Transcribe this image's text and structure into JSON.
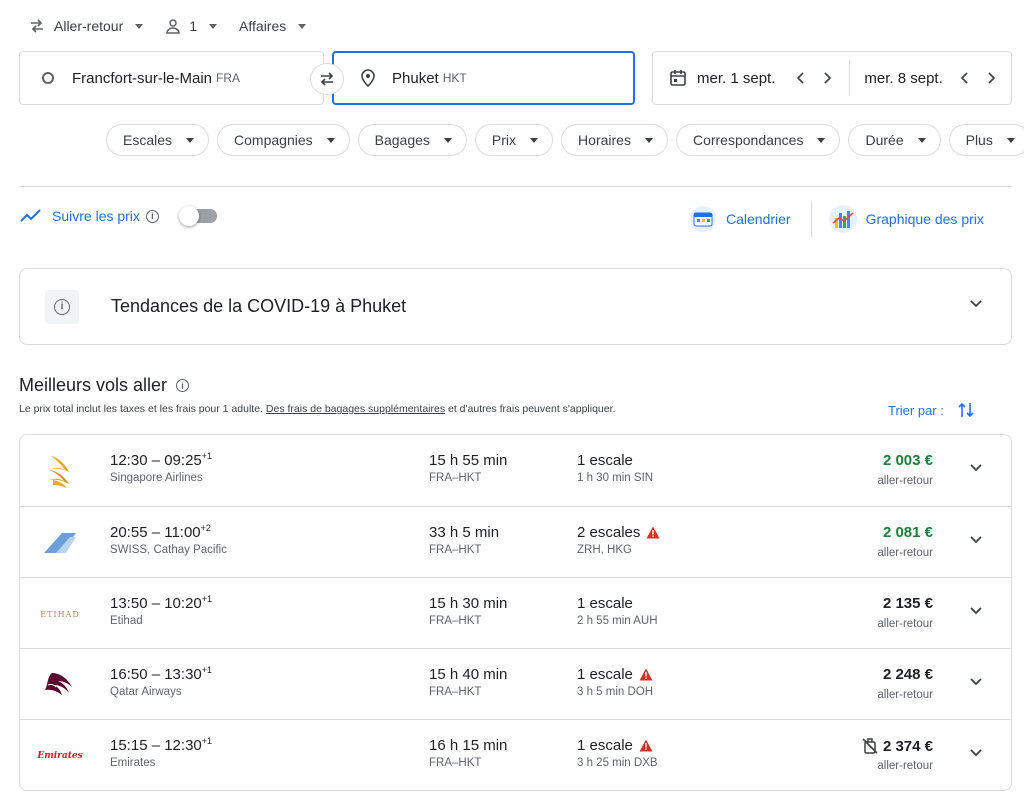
{
  "options": {
    "trip_type": "Aller-retour",
    "passengers": "1",
    "cabin": "Affaires"
  },
  "search": {
    "origin_city": "Francfort-sur-le-Main",
    "origin_code": "FRA",
    "destination_city": "Phuket",
    "destination_code": "HKT",
    "depart_date": "mer. 1 sept.",
    "return_date": "mer. 8 sept."
  },
  "filters": [
    "Escales",
    "Compagnies",
    "Bagages",
    "Prix",
    "Horaires",
    "Correspondances",
    "Durée",
    "Plus"
  ],
  "track": {
    "label": "Suivre les prix",
    "info": "i"
  },
  "views": {
    "calendar": "Calendrier",
    "price_graph": "Graphique des prix"
  },
  "covid": {
    "title": "Tendances de la COVID-19 à Phuket",
    "info": "i"
  },
  "section": {
    "title": "Meilleurs vols aller",
    "info": "i",
    "sub_before": "Le prix total inclut les taxes et les frais pour 1 adulte.",
    "sub_link": "Des frais de bagages supplémentaires",
    "sub_after": "et d'autres frais peuvent s'appliquer.",
    "sort_label": "Trier par :"
  },
  "colors": {
    "accent": "#1a73e8",
    "price_green": "#188038",
    "warning": "#d93025"
  },
  "flights": [
    {
      "times": "12:30 – 09:25",
      "day_offset": "+1",
      "airline": "Singapore Airlines",
      "duration": "15 h 55 min",
      "route": "FRA–HKT",
      "stops": "1 escale",
      "warning": false,
      "layover": "1 h 30 min SIN",
      "price": "2 003 €",
      "price_type": "aller-retour",
      "green": true,
      "no_bag": false,
      "logo": "singapore-airlines-logo"
    },
    {
      "times": "20:55 – 11:00",
      "day_offset": "+2",
      "airline": "SWISS, Cathay Pacific",
      "duration": "33 h 5 min",
      "route": "FRA–HKT",
      "stops": "2 escales",
      "warning": true,
      "layover": "ZRH, HKG",
      "price": "2 081 €",
      "price_type": "aller-retour",
      "green": true,
      "no_bag": false,
      "logo": "multi-airline-logo"
    },
    {
      "times": "13:50 – 10:20",
      "day_offset": "+1",
      "airline": "Etihad",
      "duration": "15 h 30 min",
      "route": "FRA–HKT",
      "stops": "1 escale",
      "warning": false,
      "layover": "2 h 55 min AUH",
      "price": "2 135 €",
      "price_type": "aller-retour",
      "green": false,
      "no_bag": false,
      "logo": "etihad-logo",
      "logo_text": "ETIHAD"
    },
    {
      "times": "16:50 – 13:30",
      "day_offset": "+1",
      "airline": "Qatar Airways",
      "duration": "15 h 40 min",
      "route": "FRA–HKT",
      "stops": "1 escale",
      "warning": true,
      "layover": "3 h 5 min DOH",
      "price": "2 248 €",
      "price_type": "aller-retour",
      "green": false,
      "no_bag": false,
      "logo": "qatar-airways-logo"
    },
    {
      "times": "15:15 – 12:30",
      "day_offset": "+1",
      "airline": "Emirates",
      "duration": "16 h 15 min",
      "route": "FRA–HKT",
      "stops": "1 escale",
      "warning": true,
      "layover": "3 h 25 min DXB",
      "price": "2 374 €",
      "price_type": "aller-retour",
      "green": false,
      "no_bag": true,
      "logo": "emirates-logo",
      "logo_text": "Emirates"
    }
  ]
}
